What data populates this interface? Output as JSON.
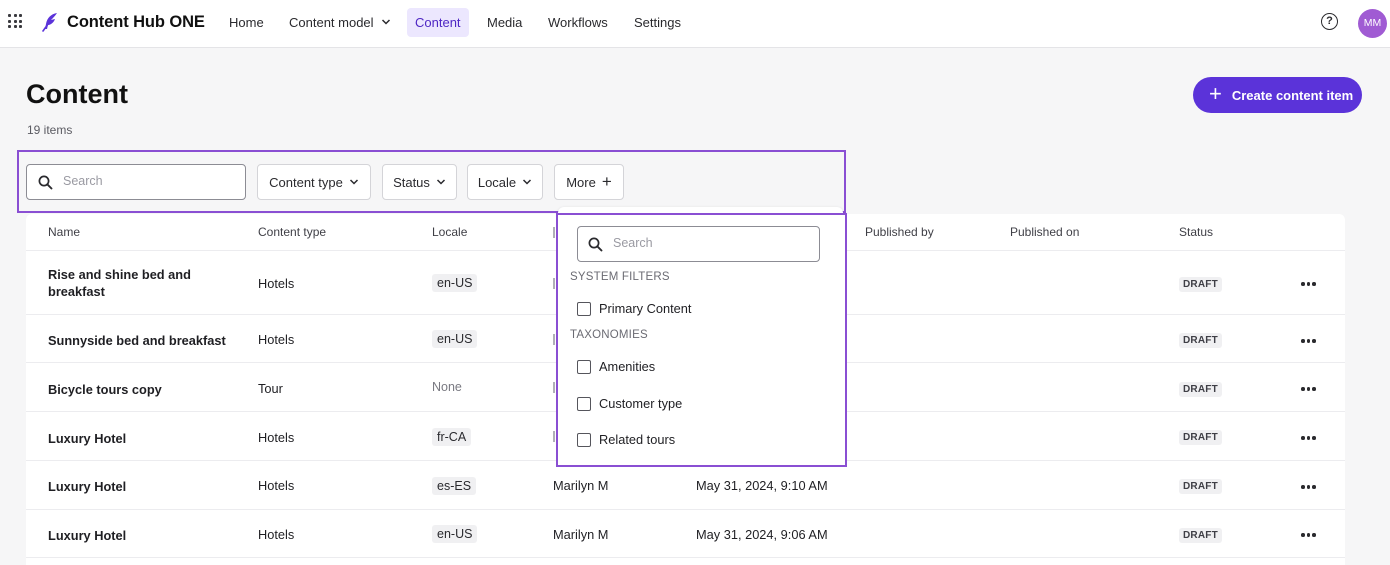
{
  "nav": {
    "brand": "Content Hub ONE",
    "items": [
      {
        "label": "Home"
      },
      {
        "label": "Content model"
      },
      {
        "label": "Content"
      },
      {
        "label": "Media"
      },
      {
        "label": "Workflows"
      },
      {
        "label": "Settings"
      }
    ],
    "active": "Content",
    "help_glyph": "?",
    "avatar_initials": "MM",
    "brand_color": "#5b33d9",
    "avatar_color": "#a05bd3"
  },
  "header": {
    "title": "Content",
    "count": "19 items",
    "create_label": "Create content item"
  },
  "filters": {
    "search_placeholder": "Search",
    "content_type": "Content type",
    "status": "Status",
    "locale": "Locale",
    "more": "More"
  },
  "table": {
    "columns": {
      "name": "Name",
      "content_type": "Content type",
      "locale": "Locale",
      "published_by": "Published by",
      "published_on": "Published on",
      "status": "Status"
    },
    "rows": [
      {
        "name": "Rise and shine bed and breakfast",
        "content_type": "Hotels",
        "locale": "en-US",
        "updated_by": "",
        "updated_on": "",
        "status": "DRAFT"
      },
      {
        "name": "Sunnyside bed and breakfast",
        "content_type": "Hotels",
        "locale": "en-US",
        "updated_by": "",
        "updated_on": "",
        "status": "DRAFT"
      },
      {
        "name": "Bicycle tours copy",
        "content_type": "Tour",
        "locale": "None",
        "updated_by": "",
        "updated_on": "",
        "status": "DRAFT"
      },
      {
        "name": "Luxury Hotel",
        "content_type": "Hotels",
        "locale": "fr-CA",
        "updated_by": "",
        "updated_on": "",
        "status": "DRAFT"
      },
      {
        "name": "Luxury Hotel",
        "content_type": "Hotels",
        "locale": "es-ES",
        "updated_by": "Marilyn M",
        "updated_on": "May 31, 2024, 9:10 AM",
        "status": "DRAFT"
      },
      {
        "name": "Luxury Hotel",
        "content_type": "Hotels",
        "locale": "en-US",
        "updated_by": "Marilyn M",
        "updated_on": "May 31, 2024, 9:06 AM",
        "status": "DRAFT"
      }
    ]
  },
  "more_dropdown": {
    "search_placeholder": "Search",
    "system_filters_label": "SYSTEM FILTERS",
    "system_filters": [
      {
        "label": "Primary Content",
        "checked": false
      }
    ],
    "taxonomies_label": "TAXONOMIES",
    "taxonomies": [
      {
        "label": "Amenities",
        "checked": false
      },
      {
        "label": "Customer type",
        "checked": false
      },
      {
        "label": "Related tours",
        "checked": false
      }
    ]
  }
}
